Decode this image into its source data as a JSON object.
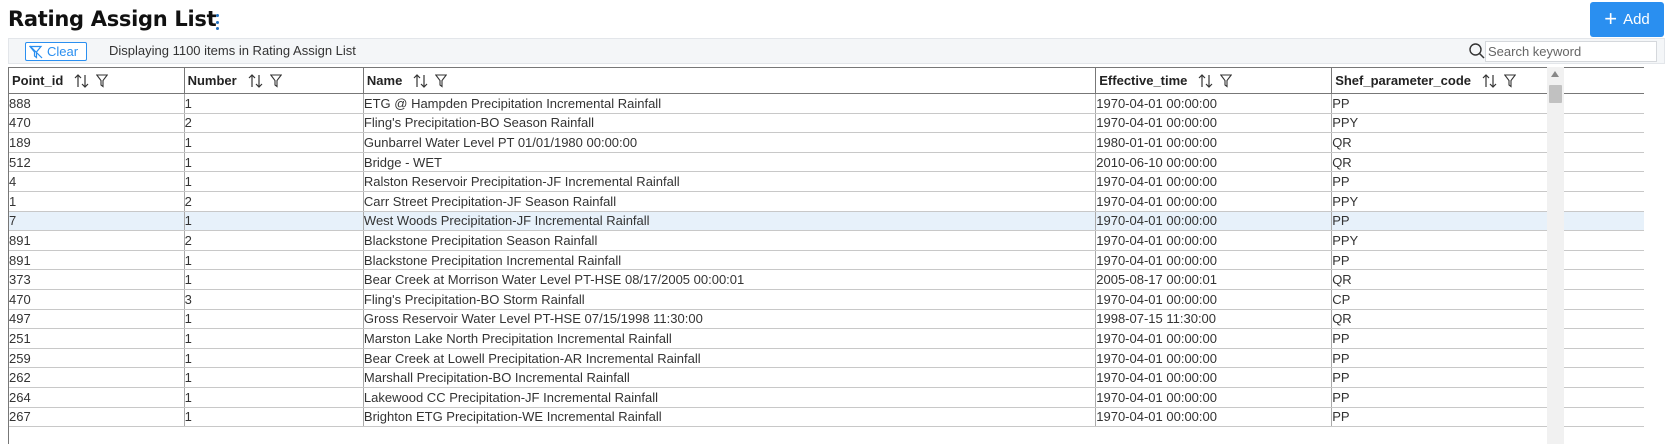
{
  "header": {
    "title": "Rating Assign List",
    "add_label": "Add"
  },
  "toolbar": {
    "clear_label": "Clear",
    "status": "Displaying 1100 items in Rating Assign List",
    "search_placeholder": "Search keyword"
  },
  "columns": [
    "Point_id",
    "Number",
    "Name",
    "Effective_time",
    "Shef_parameter_code"
  ],
  "rows": [
    [
      "888",
      "1",
      "ETG @ Hampden Precipitation Incremental Rainfall",
      "1970-04-01 00:00:00",
      "PP"
    ],
    [
      "470",
      "2",
      "Fling's Precipitation-BO Season Rainfall",
      "1970-04-01 00:00:00",
      "PPY"
    ],
    [
      "189",
      "1",
      "Gunbarrel Water Level PT 01/01/1980 00:00:00",
      "1980-01-01 00:00:00",
      "QR"
    ],
    [
      "512",
      "1",
      "Bridge - WET",
      "2010-06-10 00:00:00",
      "QR"
    ],
    [
      "4",
      "1",
      "Ralston Reservoir Precipitation-JF Incremental Rainfall",
      "1970-04-01 00:00:00",
      "PP"
    ],
    [
      "1",
      "2",
      "Carr Street Precipitation-JF Season Rainfall",
      "1970-04-01 00:00:00",
      "PPY"
    ],
    [
      "7",
      "1",
      "West Woods Precipitation-JF Incremental Rainfall",
      "1970-04-01 00:00:00",
      "PP"
    ],
    [
      "891",
      "2",
      "Blackstone Precipitation Season Rainfall",
      "1970-04-01 00:00:00",
      "PPY"
    ],
    [
      "891",
      "1",
      "Blackstone Precipitation Incremental Rainfall",
      "1970-04-01 00:00:00",
      "PP"
    ],
    [
      "373",
      "1",
      "Bear Creek at Morrison Water Level PT-HSE 08/17/2005 00:00:01",
      "2005-08-17 00:00:01",
      "QR"
    ],
    [
      "470",
      "3",
      "Fling's Precipitation-BO Storm Rainfall",
      "1970-04-01 00:00:00",
      "CP"
    ],
    [
      "497",
      "1",
      "Gross Reservoir Water Level PT-HSE 07/15/1998 11:30:00",
      "1998-07-15 11:30:00",
      "QR"
    ],
    [
      "251",
      "1",
      "Marston Lake North Precipitation Incremental Rainfall",
      "1970-04-01 00:00:00",
      "PP"
    ],
    [
      "259",
      "1",
      "Bear Creek at Lowell Precipitation-AR Incremental Rainfall",
      "1970-04-01 00:00:00",
      "PP"
    ],
    [
      "262",
      "1",
      "Marshall Precipitation-BO Incremental Rainfall",
      "1970-04-01 00:00:00",
      "PP"
    ],
    [
      "264",
      "1",
      "Lakewood CC Precipitation-JF Incremental Rainfall",
      "1970-04-01 00:00:00",
      "PP"
    ],
    [
      "267",
      "1",
      "Brighton ETG Precipitation-WE Incremental Rainfall",
      "1970-04-01 00:00:00",
      "PP"
    ]
  ],
  "selected_row": 6,
  "colors": {
    "accent": "#2a8ff0",
    "selected_row": "#e7f1fa"
  }
}
